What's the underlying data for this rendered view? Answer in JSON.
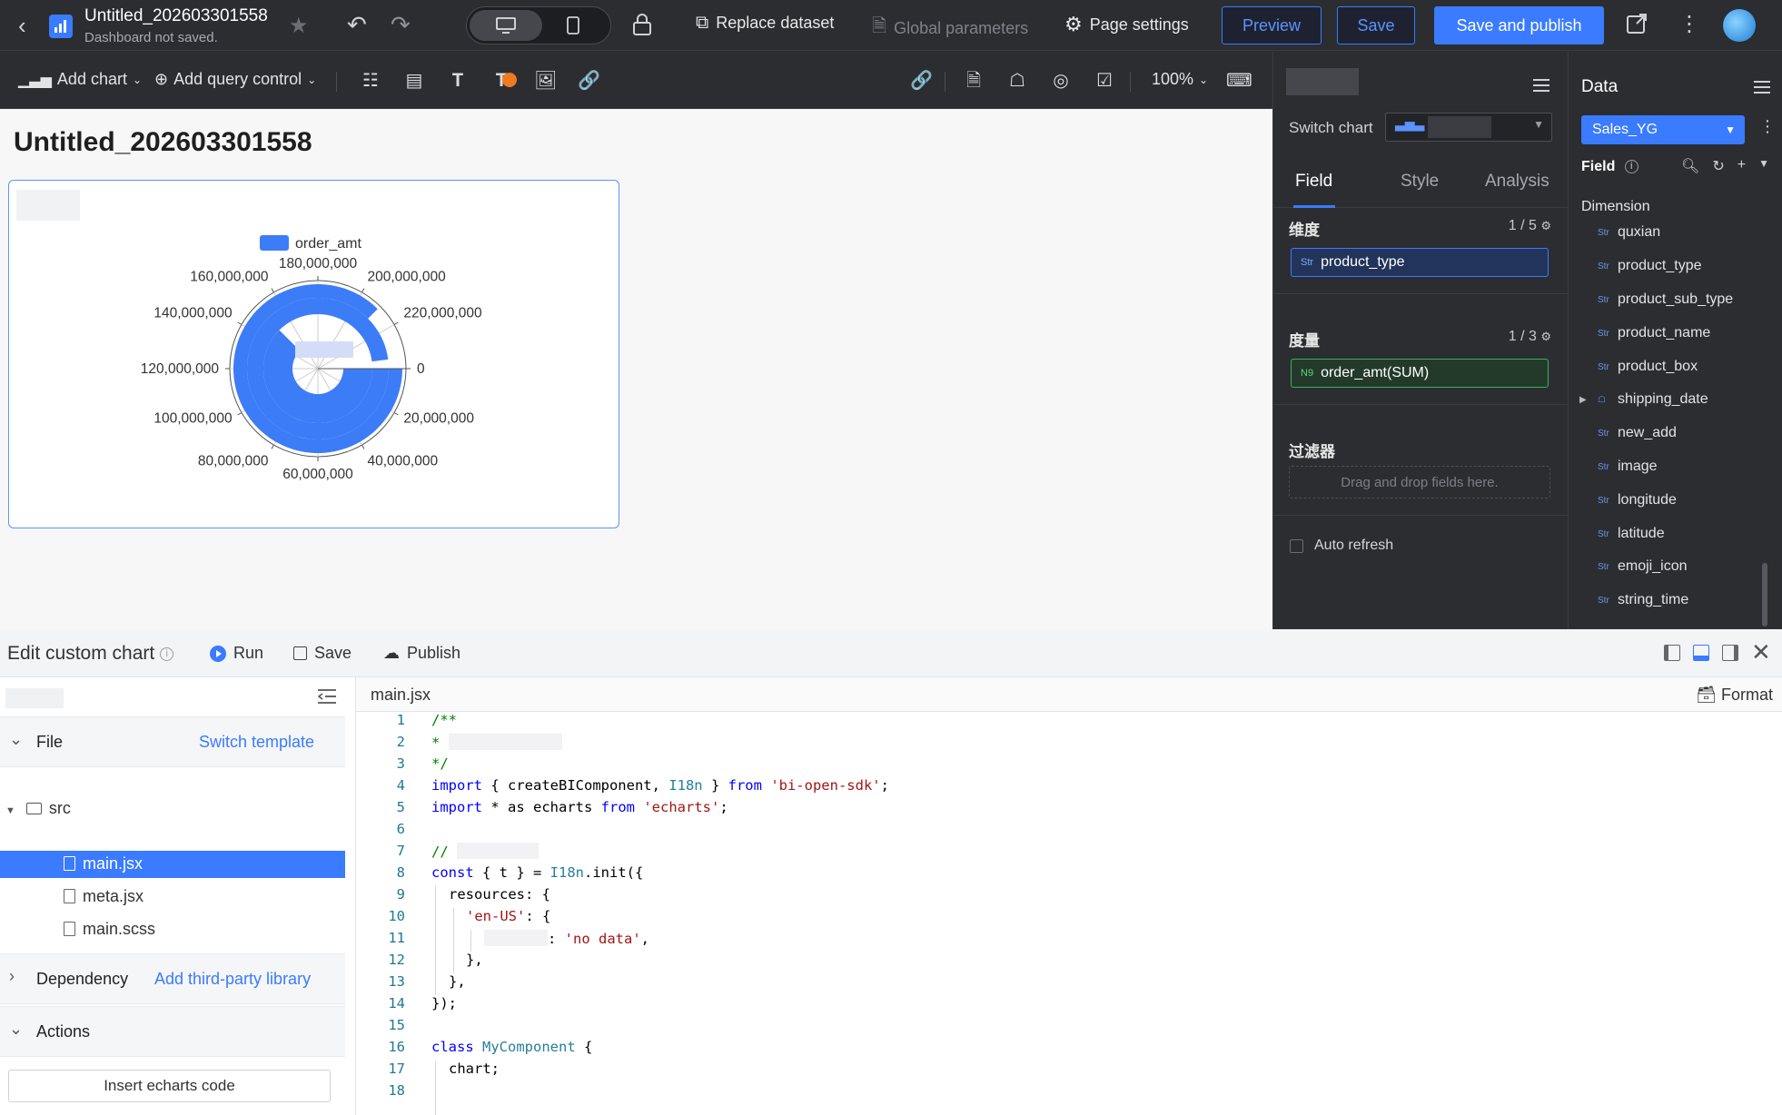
{
  "topbar": {
    "title": "Untitled_202603301558",
    "subtitle": "Dashboard not saved.",
    "replace_dataset": "Replace dataset",
    "global_parameters": "Global parameters",
    "page_settings": "Page settings",
    "preview": "Preview",
    "save": "Save",
    "save_publish": "Save and publish"
  },
  "toolbar": {
    "add_chart": "Add chart",
    "add_query_control": "Add query control",
    "zoom": "100%"
  },
  "canvas": {
    "title": "Untitled_202603301558"
  },
  "chart_data": {
    "type": "bar",
    "polar": true,
    "legend": [
      "order_amt"
    ],
    "legend_placement": "top-center",
    "angle_axis_ticks": [
      "0",
      "20,000,000",
      "40,000,000",
      "60,000,000",
      "80,000,000",
      "100,000,000",
      "120,000,000",
      "140,000,000",
      "160,000,000",
      "180,000,000",
      "200,000,000",
      "220,000,000"
    ],
    "angle_axis_max": 240000000,
    "series": [
      {
        "name": "order_amt",
        "values": [
          150000000,
          210000000,
          235000000
        ]
      }
    ],
    "color": "#3d7cf7"
  },
  "config": {
    "switch_chart": "Switch chart",
    "tabs": [
      "Field",
      "Style",
      "Analysis"
    ],
    "dimension_label": "维度",
    "dimension_count": "1 / 5",
    "dimension_field": "product_type",
    "measure_label": "度量",
    "measure_count": "1 / 3",
    "measure_field": "order_amt(SUM)",
    "filter_label": "过滤器",
    "drop_hint": "Drag and drop fields here.",
    "auto_refresh": "Auto refresh",
    "str_tag": "Str",
    "num_tag": "N9"
  },
  "data": {
    "title": "Data",
    "dataset": "Sales_YG",
    "field_label": "Field",
    "dimension_head": "Dimension",
    "dimensions": [
      "quxian",
      "product_type",
      "product_sub_type",
      "product_name",
      "product_box",
      "shipping_date",
      "new_add",
      "image",
      "longitude",
      "latitude",
      "emoji_icon",
      "string_time"
    ]
  },
  "editor": {
    "title": "Edit custom chart",
    "run": "Run",
    "save": "Save",
    "publish": "Publish",
    "file_section": "File",
    "switch_template": "Switch template",
    "folder": "src",
    "files": [
      "main.jsx",
      "meta.jsx",
      "main.scss"
    ],
    "dependency": "Dependency",
    "add_library": "Add third-party library",
    "actions": "Actions",
    "insert_echarts": "Insert echarts code",
    "tab": "main.jsx",
    "format": "Format",
    "code": {
      "l1": "/**",
      "l2": "*",
      "l3": "*/",
      "l4a": "import",
      "l4b": " { createBIComponent, ",
      "l4c": "I18n",
      "l4d": " } ",
      "l4e": "from",
      "l4f": "'bi-open-sdk'",
      "l4g": ";",
      "l5a": "import",
      "l5b": " * as echarts ",
      "l5c": "from",
      "l5d": "'echarts'",
      "l5e": ";",
      "l7": "//",
      "l8a": "const",
      "l8b": " { t } = ",
      "l8c": "I18n",
      "l8d": ".init({",
      "l9": "resources: {",
      "l10a": "'en-US'",
      "l10b": ": {",
      "l11a": ": ",
      "l11b": "'no data'",
      "l11c": ",",
      "l12": "},",
      "l13": "},",
      "l14": "});",
      "l16a": "class",
      "l16b": "MyComponent",
      "l16c": " {",
      "l17": "chart;"
    }
  }
}
